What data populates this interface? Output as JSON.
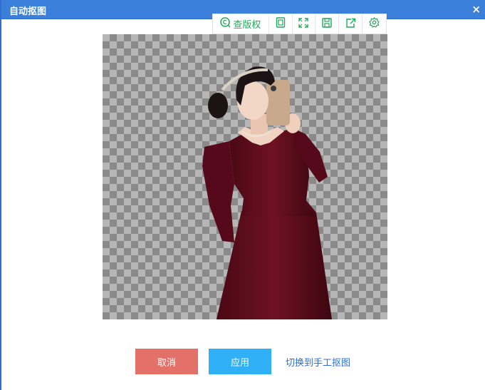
{
  "dialog": {
    "title": "自动抠图",
    "close_symbol": "×"
  },
  "toolbar": {
    "copyright_label": "查版权",
    "icons": [
      "copyright-search-icon",
      "copy-icon",
      "fullscreen-icon",
      "save-icon",
      "share-icon",
      "settings-icon"
    ],
    "accent": "#22a95a"
  },
  "canvas": {
    "image": "cutout photo of woman in long burgundy velvet dress taking a mirror selfie, transparent checkerboard background"
  },
  "actions": {
    "cancel_label": "取消",
    "apply_label": "应用",
    "switch_label": "切换到手工抠图"
  },
  "colors": {
    "title_bar": "#3a7fd9",
    "cancel": "#e4706a",
    "apply": "#2fb0f7",
    "link": "#2d6fd1"
  }
}
